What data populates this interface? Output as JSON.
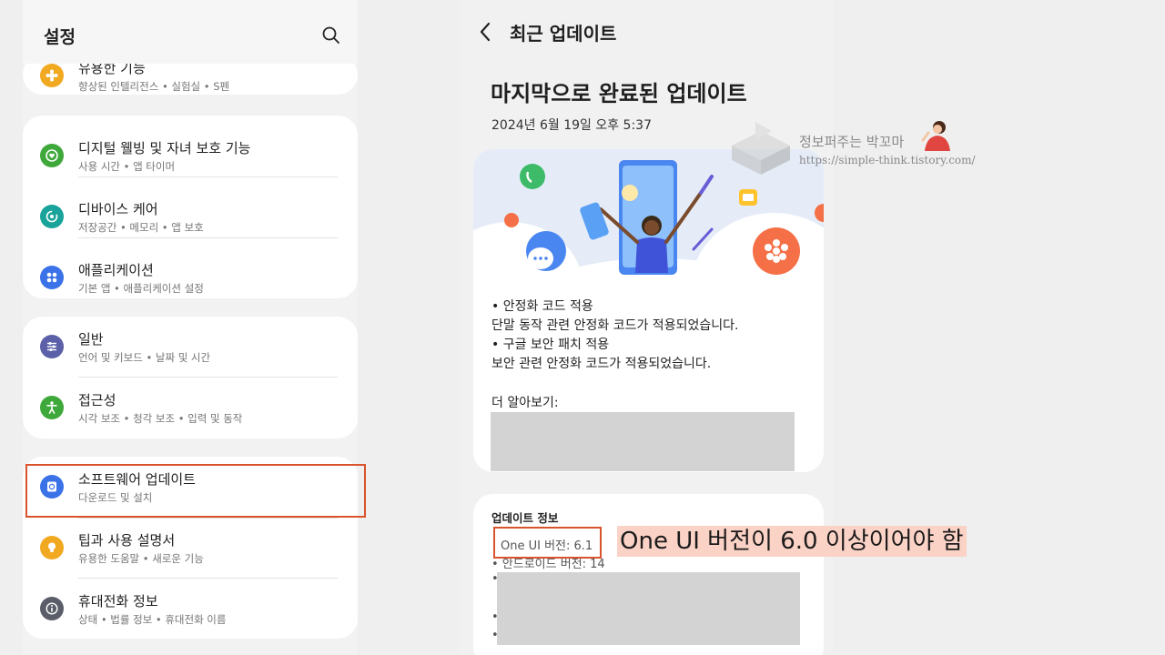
{
  "settings": {
    "title": "설정",
    "partial_item": {
      "title": "유용한 기능",
      "subtitle": "향상된 인텔리전스 • 실험실 • S펜"
    },
    "items": [
      {
        "title": "디지털 웰빙 및 자녀 보호 기능",
        "subtitle": "사용 시간 • 앱 타이머",
        "icon": "digital-wellbeing-icon",
        "color": "#3fa83a"
      },
      {
        "title": "디바이스 케어",
        "subtitle": "저장공간 • 메모리 • 앱 보호",
        "icon": "device-care-icon",
        "color": "#1aa39a"
      },
      {
        "title": "애플리케이션",
        "subtitle": "기본 앱 • 애플리케이션 설정",
        "icon": "apps-icon",
        "color": "#3b72e8"
      },
      {
        "title": "일반",
        "subtitle": "언어 및 키보드 • 날짜 및 시간",
        "icon": "general-management-icon",
        "color": "#5b60a8"
      },
      {
        "title": "접근성",
        "subtitle": "시각 보조 • 청각 보조 • 입력 및 동작",
        "icon": "accessibility-icon",
        "color": "#3fa83a"
      },
      {
        "title": "소프트웨어 업데이트",
        "subtitle": "다운로드 및 설치",
        "icon": "software-update-icon",
        "color": "#3b72e8"
      },
      {
        "title": "팁과 사용 설명서",
        "subtitle": "유용한 도움말 • 새로운 기능",
        "icon": "tips-icon",
        "color": "#f2a922"
      },
      {
        "title": "휴대전화 정보",
        "subtitle": "상태 • 법률 정보 • 휴대전화 이름",
        "icon": "about-phone-icon",
        "color": "#5b5e69"
      }
    ]
  },
  "update": {
    "screen_title": "최근 업데이트",
    "headline": "마지막으로 완료된 업데이트",
    "date": "2024년 6월 19일 오후 5:37",
    "description": [
      "• 안정화 코드 적용",
      "단말 동작 관련 안정화 코드가 적용되었습니다.",
      "• 구글 보안 패치 적용",
      "보안 관련 안정화 코드가 적용되었습니다."
    ],
    "learn_more": "더 알아보기:",
    "info_title": "업데이트 정보",
    "one_ui_version": "One UI 버전: 6.1",
    "android_version": "• 안드로이드 버전: 14"
  },
  "watermark": {
    "name": "정보퍼주는 박꼬마",
    "url": "https://simple-think.tistory.com/"
  },
  "annotation": "One UI 버전이 6.0 이상이어야 함",
  "colors": {
    "highlight": "#d9532d",
    "annotation_bg": "#fbd2c6"
  }
}
